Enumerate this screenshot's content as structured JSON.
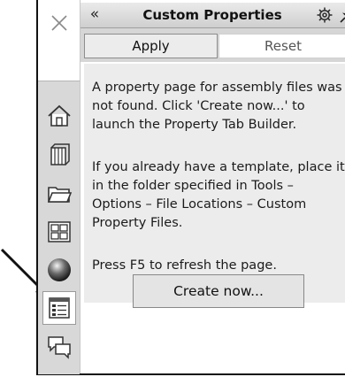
{
  "panel": {
    "title": "Custom Properties",
    "collapse_glyph": "«",
    "apply_label": "Apply",
    "reset_label": "Reset",
    "message": {
      "p1": "A property page for assembly files was not found. Click 'Create now...' to launch the Property Tab Builder.",
      "p2": "If you already have a template, place it in the folder specified in Tools – Options – File Locations – Custom Property Files.",
      "p3": "Press F5 to refresh the page."
    },
    "create_label": "Create now..."
  },
  "rail": {
    "close_icon": "close-icon",
    "items": [
      {
        "icon": "home-icon",
        "active": false
      },
      {
        "icon": "design-library-icon",
        "active": false
      },
      {
        "icon": "file-explorer-folder-icon",
        "active": false
      },
      {
        "icon": "view-palette-icon",
        "active": false
      },
      {
        "icon": "appearances-sphere-icon",
        "active": false
      },
      {
        "icon": "custom-properties-icon",
        "active": true
      },
      {
        "icon": "forum-chat-icon",
        "active": false
      }
    ]
  },
  "colors": {
    "panel_background": "#ececec",
    "rail_background": "#d8d8d8",
    "callout_arrow": "#111111"
  }
}
